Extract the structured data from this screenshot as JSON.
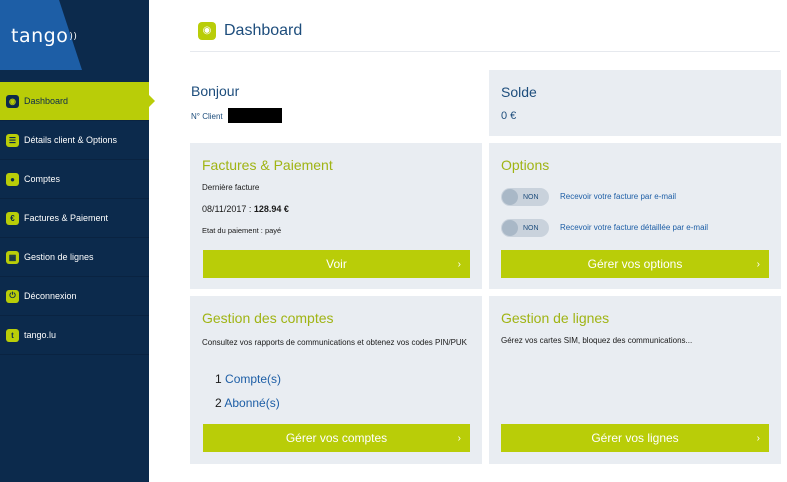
{
  "brand": {
    "logo_text": "tango",
    "logo_waves": "))"
  },
  "sidebar": {
    "items": [
      {
        "label": "Dashboard",
        "icon": "dashboard-icon",
        "glyph": "◉",
        "active": true
      },
      {
        "label": "Détails client & Options",
        "icon": "client-details-icon",
        "glyph": "☰",
        "active": false
      },
      {
        "label": "Comptes",
        "icon": "accounts-icon",
        "glyph": "●",
        "active": false
      },
      {
        "label": "Factures & Paiement",
        "icon": "invoice-icon",
        "glyph": "€",
        "active": false
      },
      {
        "label": "Gestion de lignes",
        "icon": "lines-icon",
        "glyph": "▦",
        "active": false
      },
      {
        "label": "Déconnexion",
        "icon": "power-icon",
        "glyph": "⏻",
        "active": false
      },
      {
        "label": "tango.lu",
        "icon": "website-icon",
        "glyph": "t",
        "active": false
      }
    ]
  },
  "header": {
    "title": "Dashboard",
    "icon": "dashboard-icon"
  },
  "greeting": {
    "title": "Bonjour",
    "client_label": "N° Client"
  },
  "balance": {
    "title": "Solde",
    "amount": "0 €"
  },
  "invoices": {
    "title": "Factures & Paiement",
    "last_invoice_label": "Dernière facture",
    "date": "08/11/2017 :",
    "amount": "128.94 €",
    "payment_status": "Etat du paiement : payé",
    "button": "Voir"
  },
  "options": {
    "title": "Options",
    "toggles": [
      {
        "state": "NON",
        "label": "Recevoir votre facture par e-mail"
      },
      {
        "state": "NON",
        "label": "Recevoir votre facture détaillée par e-mail"
      }
    ],
    "button": "Gérer vos options"
  },
  "accounts": {
    "title": "Gestion des comptes",
    "description": "Consultez vos rapports de communications et obtenez vos codes PIN/PUK",
    "accounts_count": "1",
    "accounts_label": "Compte(s)",
    "subscribers_count": "2",
    "subscribers_label": "Abonné(s)",
    "button": "Gérer vos comptes"
  },
  "lines": {
    "title": "Gestion de lignes",
    "description": "Gérez vos cartes SIM, bloquez des communications...",
    "button": "Gérer vos lignes"
  },
  "colors": {
    "sidebar": "#0c2a4c",
    "accent": "#b9cd08",
    "title_blue": "#1d4d7c",
    "card_bg": "#e9edf2"
  }
}
